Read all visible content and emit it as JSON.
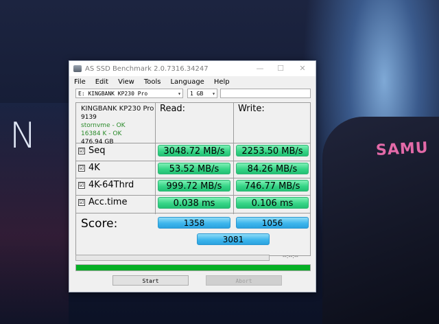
{
  "window": {
    "title": "AS SSD Benchmark 2.0.7316.34247",
    "controls": {
      "minimize": "—",
      "maximize": "☐",
      "close": "✕"
    }
  },
  "menu": [
    "File",
    "Edit",
    "View",
    "Tools",
    "Language",
    "Help"
  ],
  "toolbar": {
    "drive": "E: KINGBANK KP230 Pro",
    "size": "1 GB",
    "blank": ""
  },
  "drive_info": {
    "model": "KINGBANK KP230 Pro",
    "firmware": "9139",
    "driver": "stornvme - OK",
    "alignment": "16384 K - OK",
    "capacity": "476.94 GB"
  },
  "columns": {
    "read": "Read:",
    "write": "Write:"
  },
  "rows": [
    {
      "label": "Seq",
      "checked": "☑",
      "read": "3048.72 MB/s",
      "write": "2253.50 MB/s"
    },
    {
      "label": "4K",
      "checked": "☑",
      "read": "53.52 MB/s",
      "write": "84.26 MB/s"
    },
    {
      "label": "4K-64Thrd",
      "checked": "☑",
      "read": "999.72 MB/s",
      "write": "746.77 MB/s"
    },
    {
      "label": "Acc.time",
      "checked": "☑",
      "read": "0.038 ms",
      "write": "0.106 ms"
    }
  ],
  "score": {
    "label": "Score:",
    "read": "1358",
    "write": "1056",
    "total": "3081"
  },
  "progress": {
    "time": "--:--:--",
    "value": 1.0
  },
  "buttons": {
    "start": "Start",
    "abort": "Abort"
  },
  "colors": {
    "result_green": "#37d587",
    "score_blue": "#3eb6ec",
    "progress_green": "#06b025"
  },
  "wallpaper": {
    "letter": "N",
    "jacket_text": "SAMU"
  }
}
